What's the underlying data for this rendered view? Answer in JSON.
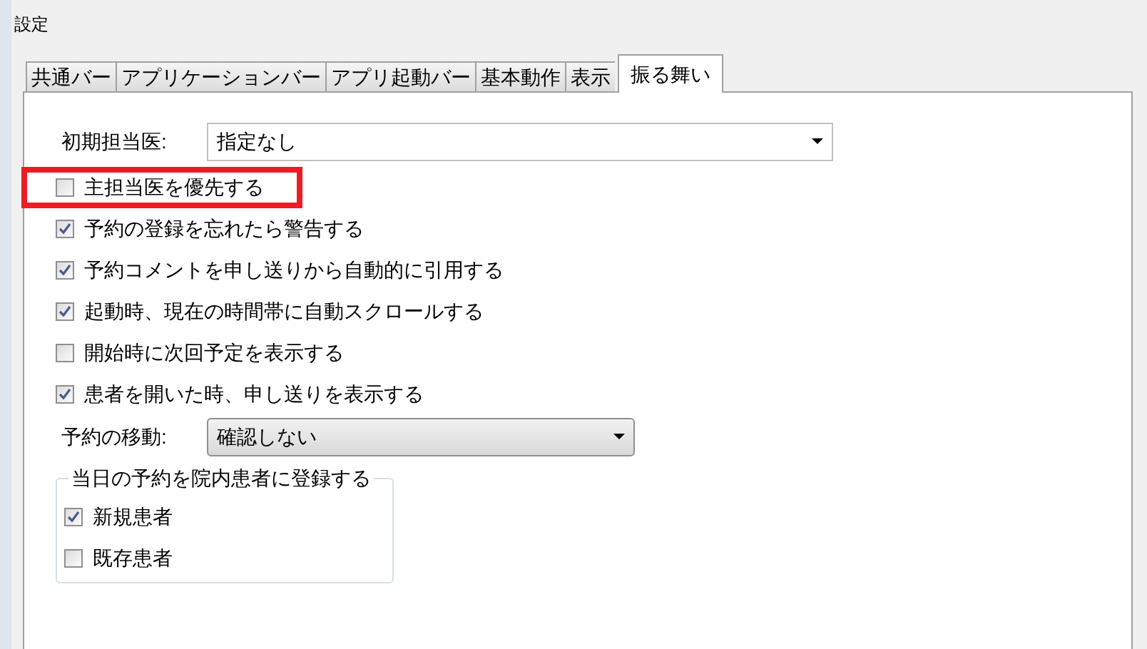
{
  "window": {
    "title": "設定"
  },
  "tabs": [
    {
      "label": "共通バー",
      "selected": false
    },
    {
      "label": "アプリケーションバー",
      "selected": false
    },
    {
      "label": "アプリ起動バー",
      "selected": false
    },
    {
      "label": "基本動作",
      "selected": false
    },
    {
      "label": "表示",
      "selected": false
    },
    {
      "label": "振る舞い",
      "selected": true
    }
  ],
  "initial_doctor": {
    "label": "初期担当医:",
    "value": "指定なし"
  },
  "options": [
    {
      "label": "主担当医を優先する",
      "checked": false,
      "highlighted": true
    },
    {
      "label": "予約の登録を忘れたら警告する",
      "checked": true,
      "highlighted": false
    },
    {
      "label": "予約コメントを申し送りから自動的に引用する",
      "checked": true,
      "highlighted": false
    },
    {
      "label": "起動時、現在の時間帯に自動スクロールする",
      "checked": true,
      "highlighted": false
    },
    {
      "label": "開始時に次回予定を表示する",
      "checked": false,
      "highlighted": false
    },
    {
      "label": "患者を開いた時、申し送りを表示する",
      "checked": true,
      "highlighted": false
    }
  ],
  "move_appointment": {
    "label": "予約の移動:",
    "value": "確認しない"
  },
  "register_group": {
    "title": "当日の予約を院内患者に登録する",
    "items": [
      {
        "label": "新規患者",
        "checked": true
      },
      {
        "label": "既存患者",
        "checked": false
      }
    ]
  }
}
